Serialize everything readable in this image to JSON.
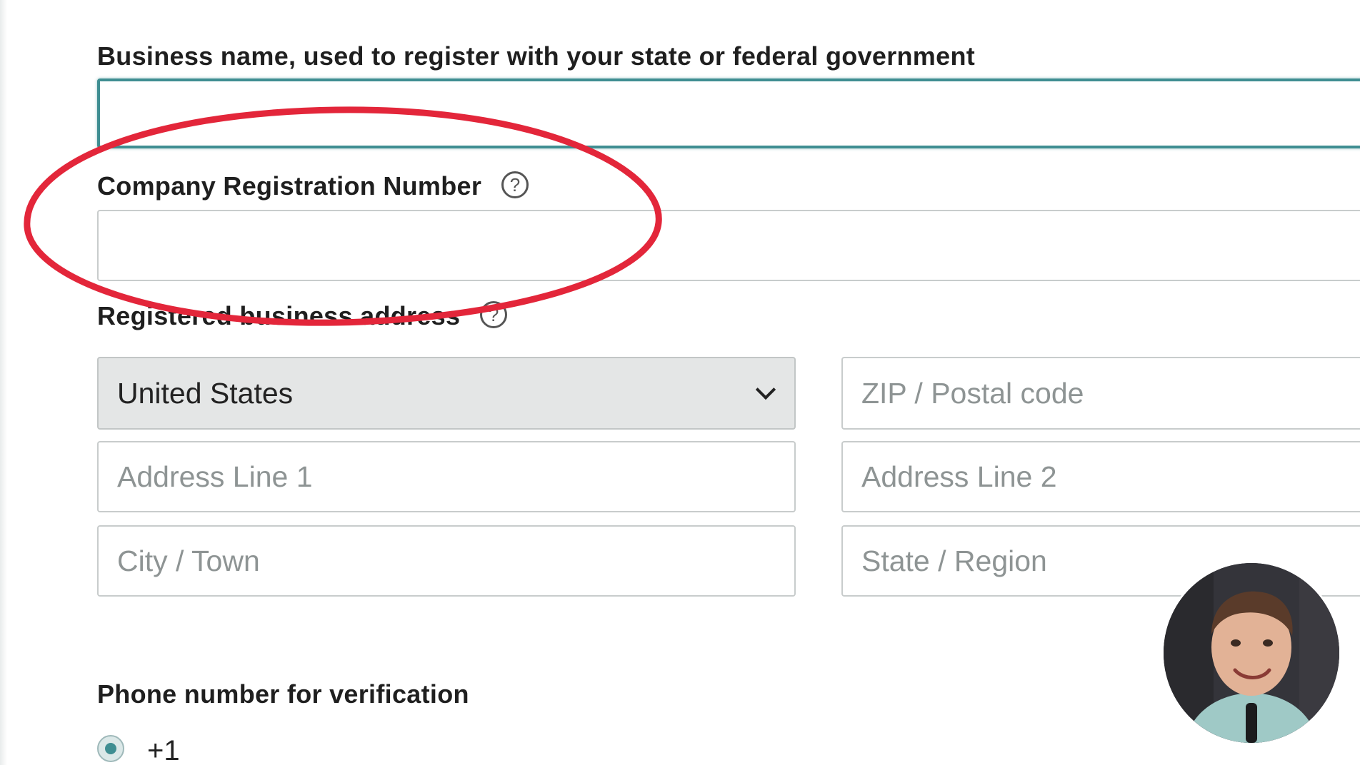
{
  "form": {
    "business_name": {
      "label": "Business name, used to register with your state or federal government",
      "value": ""
    },
    "company_registration": {
      "label": "Company Registration Number",
      "help_icon": "?",
      "value": ""
    },
    "registered_address": {
      "label": "Registered business address",
      "help_icon": "?",
      "country": "United States",
      "zip_placeholder": "ZIP / Postal code",
      "address1_placeholder": "Address Line 1",
      "address2_placeholder": "Address Line 2",
      "city_placeholder": "City / Town",
      "state_placeholder": "State / Region"
    },
    "phone": {
      "label": "Phone number for verification",
      "country_code": "+1"
    }
  },
  "icons": {
    "help": "question-circle-icon",
    "dropdown": "chevron-down-icon"
  },
  "colors": {
    "focus_border": "#3f8e92",
    "annotation_red": "#e3263a",
    "select_background": "#e4e6e6"
  }
}
